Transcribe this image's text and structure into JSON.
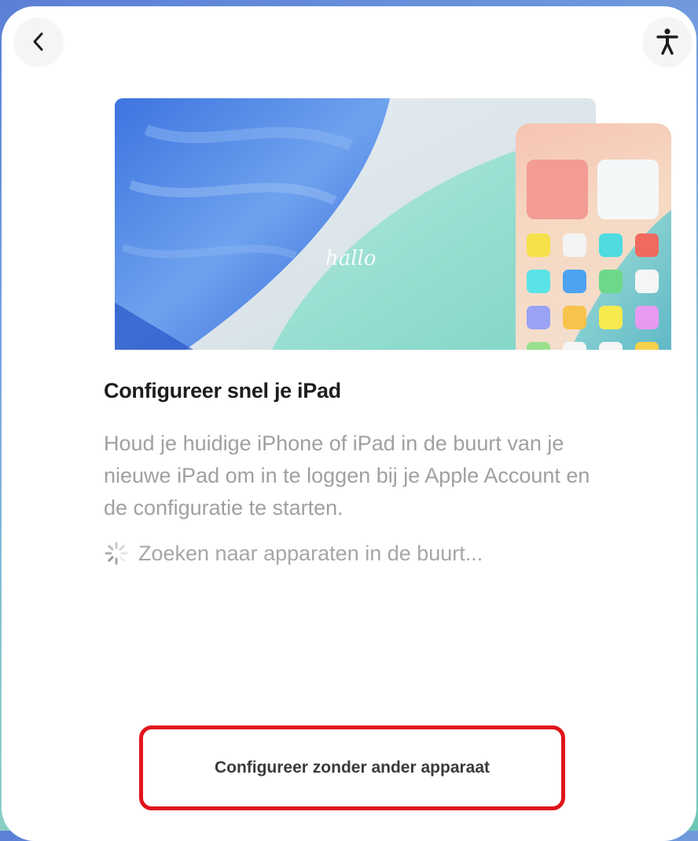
{
  "nav": {
    "back_icon": "chevron-left-icon",
    "accessibility_icon": "accessibility-icon"
  },
  "hero": {
    "greeting_text": "hallo"
  },
  "content": {
    "title": "Configureer snel je iPad",
    "description": "Houd je huidige iPhone of iPad in de buurt van je nieuwe iPad om in te loggen bij je Apple Account en de configuratie te starten.",
    "status_text": "Zoeken naar apparaten in de buurt..."
  },
  "actions": {
    "setup_without_device_label": "Configureer zonder ander apparaat"
  },
  "colors": {
    "highlight_border": "#e1141c",
    "title_text": "#1d1d1f",
    "secondary_text": "#a0a0a4"
  }
}
